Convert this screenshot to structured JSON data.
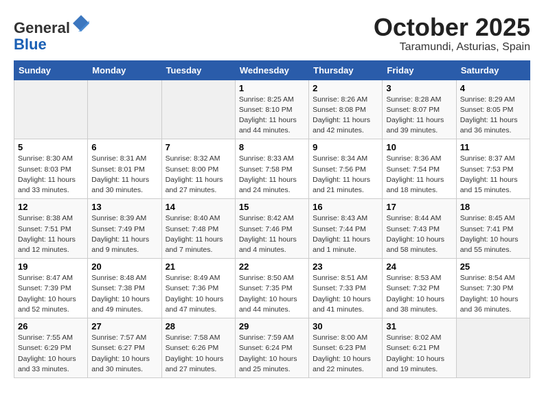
{
  "header": {
    "logo_line1": "General",
    "logo_line2": "Blue",
    "month_title": "October 2025",
    "location": "Taramundi, Asturias, Spain"
  },
  "weekdays": [
    "Sunday",
    "Monday",
    "Tuesday",
    "Wednesday",
    "Thursday",
    "Friday",
    "Saturday"
  ],
  "weeks": [
    [
      {
        "day": "",
        "info": ""
      },
      {
        "day": "",
        "info": ""
      },
      {
        "day": "",
        "info": ""
      },
      {
        "day": "1",
        "info": "Sunrise: 8:25 AM\nSunset: 8:10 PM\nDaylight: 11 hours\nand 44 minutes."
      },
      {
        "day": "2",
        "info": "Sunrise: 8:26 AM\nSunset: 8:08 PM\nDaylight: 11 hours\nand 42 minutes."
      },
      {
        "day": "3",
        "info": "Sunrise: 8:28 AM\nSunset: 8:07 PM\nDaylight: 11 hours\nand 39 minutes."
      },
      {
        "day": "4",
        "info": "Sunrise: 8:29 AM\nSunset: 8:05 PM\nDaylight: 11 hours\nand 36 minutes."
      }
    ],
    [
      {
        "day": "5",
        "info": "Sunrise: 8:30 AM\nSunset: 8:03 PM\nDaylight: 11 hours\nand 33 minutes."
      },
      {
        "day": "6",
        "info": "Sunrise: 8:31 AM\nSunset: 8:01 PM\nDaylight: 11 hours\nand 30 minutes."
      },
      {
        "day": "7",
        "info": "Sunrise: 8:32 AM\nSunset: 8:00 PM\nDaylight: 11 hours\nand 27 minutes."
      },
      {
        "day": "8",
        "info": "Sunrise: 8:33 AM\nSunset: 7:58 PM\nDaylight: 11 hours\nand 24 minutes."
      },
      {
        "day": "9",
        "info": "Sunrise: 8:34 AM\nSunset: 7:56 PM\nDaylight: 11 hours\nand 21 minutes."
      },
      {
        "day": "10",
        "info": "Sunrise: 8:36 AM\nSunset: 7:54 PM\nDaylight: 11 hours\nand 18 minutes."
      },
      {
        "day": "11",
        "info": "Sunrise: 8:37 AM\nSunset: 7:53 PM\nDaylight: 11 hours\nand 15 minutes."
      }
    ],
    [
      {
        "day": "12",
        "info": "Sunrise: 8:38 AM\nSunset: 7:51 PM\nDaylight: 11 hours\nand 12 minutes."
      },
      {
        "day": "13",
        "info": "Sunrise: 8:39 AM\nSunset: 7:49 PM\nDaylight: 11 hours\nand 9 minutes."
      },
      {
        "day": "14",
        "info": "Sunrise: 8:40 AM\nSunset: 7:48 PM\nDaylight: 11 hours\nand 7 minutes."
      },
      {
        "day": "15",
        "info": "Sunrise: 8:42 AM\nSunset: 7:46 PM\nDaylight: 11 hours\nand 4 minutes."
      },
      {
        "day": "16",
        "info": "Sunrise: 8:43 AM\nSunset: 7:44 PM\nDaylight: 11 hours\nand 1 minute."
      },
      {
        "day": "17",
        "info": "Sunrise: 8:44 AM\nSunset: 7:43 PM\nDaylight: 10 hours\nand 58 minutes."
      },
      {
        "day": "18",
        "info": "Sunrise: 8:45 AM\nSunset: 7:41 PM\nDaylight: 10 hours\nand 55 minutes."
      }
    ],
    [
      {
        "day": "19",
        "info": "Sunrise: 8:47 AM\nSunset: 7:39 PM\nDaylight: 10 hours\nand 52 minutes."
      },
      {
        "day": "20",
        "info": "Sunrise: 8:48 AM\nSunset: 7:38 PM\nDaylight: 10 hours\nand 49 minutes."
      },
      {
        "day": "21",
        "info": "Sunrise: 8:49 AM\nSunset: 7:36 PM\nDaylight: 10 hours\nand 47 minutes."
      },
      {
        "day": "22",
        "info": "Sunrise: 8:50 AM\nSunset: 7:35 PM\nDaylight: 10 hours\nand 44 minutes."
      },
      {
        "day": "23",
        "info": "Sunrise: 8:51 AM\nSunset: 7:33 PM\nDaylight: 10 hours\nand 41 minutes."
      },
      {
        "day": "24",
        "info": "Sunrise: 8:53 AM\nSunset: 7:32 PM\nDaylight: 10 hours\nand 38 minutes."
      },
      {
        "day": "25",
        "info": "Sunrise: 8:54 AM\nSunset: 7:30 PM\nDaylight: 10 hours\nand 36 minutes."
      }
    ],
    [
      {
        "day": "26",
        "info": "Sunrise: 7:55 AM\nSunset: 6:29 PM\nDaylight: 10 hours\nand 33 minutes."
      },
      {
        "day": "27",
        "info": "Sunrise: 7:57 AM\nSunset: 6:27 PM\nDaylight: 10 hours\nand 30 minutes."
      },
      {
        "day": "28",
        "info": "Sunrise: 7:58 AM\nSunset: 6:26 PM\nDaylight: 10 hours\nand 27 minutes."
      },
      {
        "day": "29",
        "info": "Sunrise: 7:59 AM\nSunset: 6:24 PM\nDaylight: 10 hours\nand 25 minutes."
      },
      {
        "day": "30",
        "info": "Sunrise: 8:00 AM\nSunset: 6:23 PM\nDaylight: 10 hours\nand 22 minutes."
      },
      {
        "day": "31",
        "info": "Sunrise: 8:02 AM\nSunset: 6:21 PM\nDaylight: 10 hours\nand 19 minutes."
      },
      {
        "day": "",
        "info": ""
      }
    ]
  ]
}
